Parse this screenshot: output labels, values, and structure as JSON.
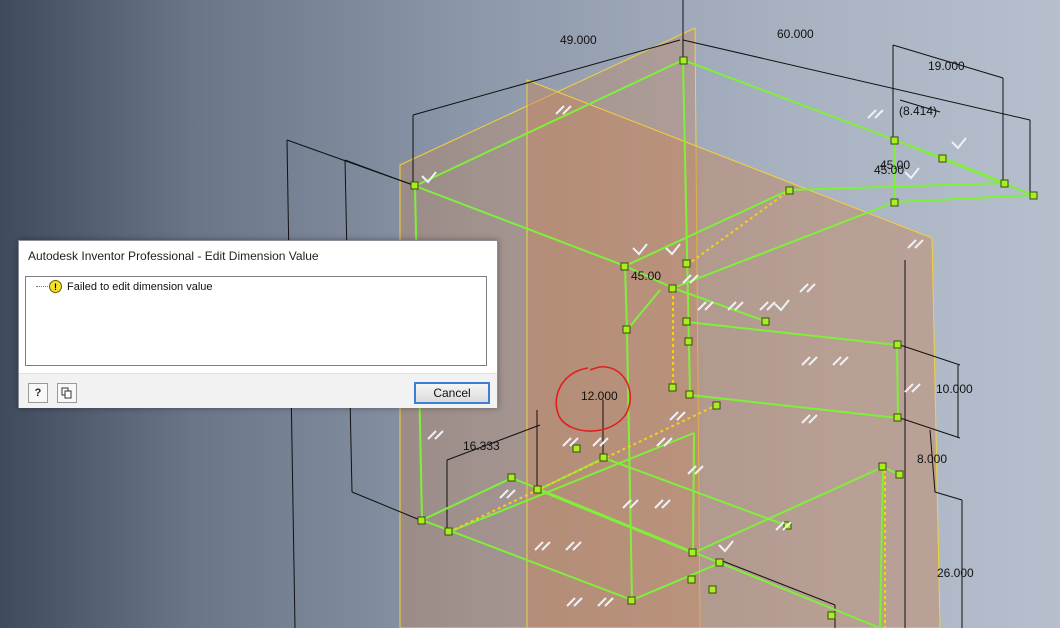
{
  "dialog": {
    "title": "Autodesk Inventor Professional - Edit Dimension Value",
    "message": "Failed to edit dimension value",
    "cancel_label": "Cancel",
    "help_icon": "help-icon",
    "copy_icon": "copy-icon",
    "warning_icon": "warning-icon"
  },
  "dimensions": {
    "d1": "49.000",
    "d2": "60.000",
    "d3": "19.000",
    "d4": "(8.414)",
    "d5": "45.00",
    "d6": "45.00",
    "d7": "45.00",
    "d8": "12.000",
    "d9": "16.333",
    "d10": "10.000",
    "d11": "8.000",
    "d12": "26.000"
  },
  "colors": {
    "sketch_green": "#7ff03a",
    "plane_fill": "#c8865a",
    "plane_edge": "#f2d23a",
    "annotation_red": "#e02020"
  }
}
